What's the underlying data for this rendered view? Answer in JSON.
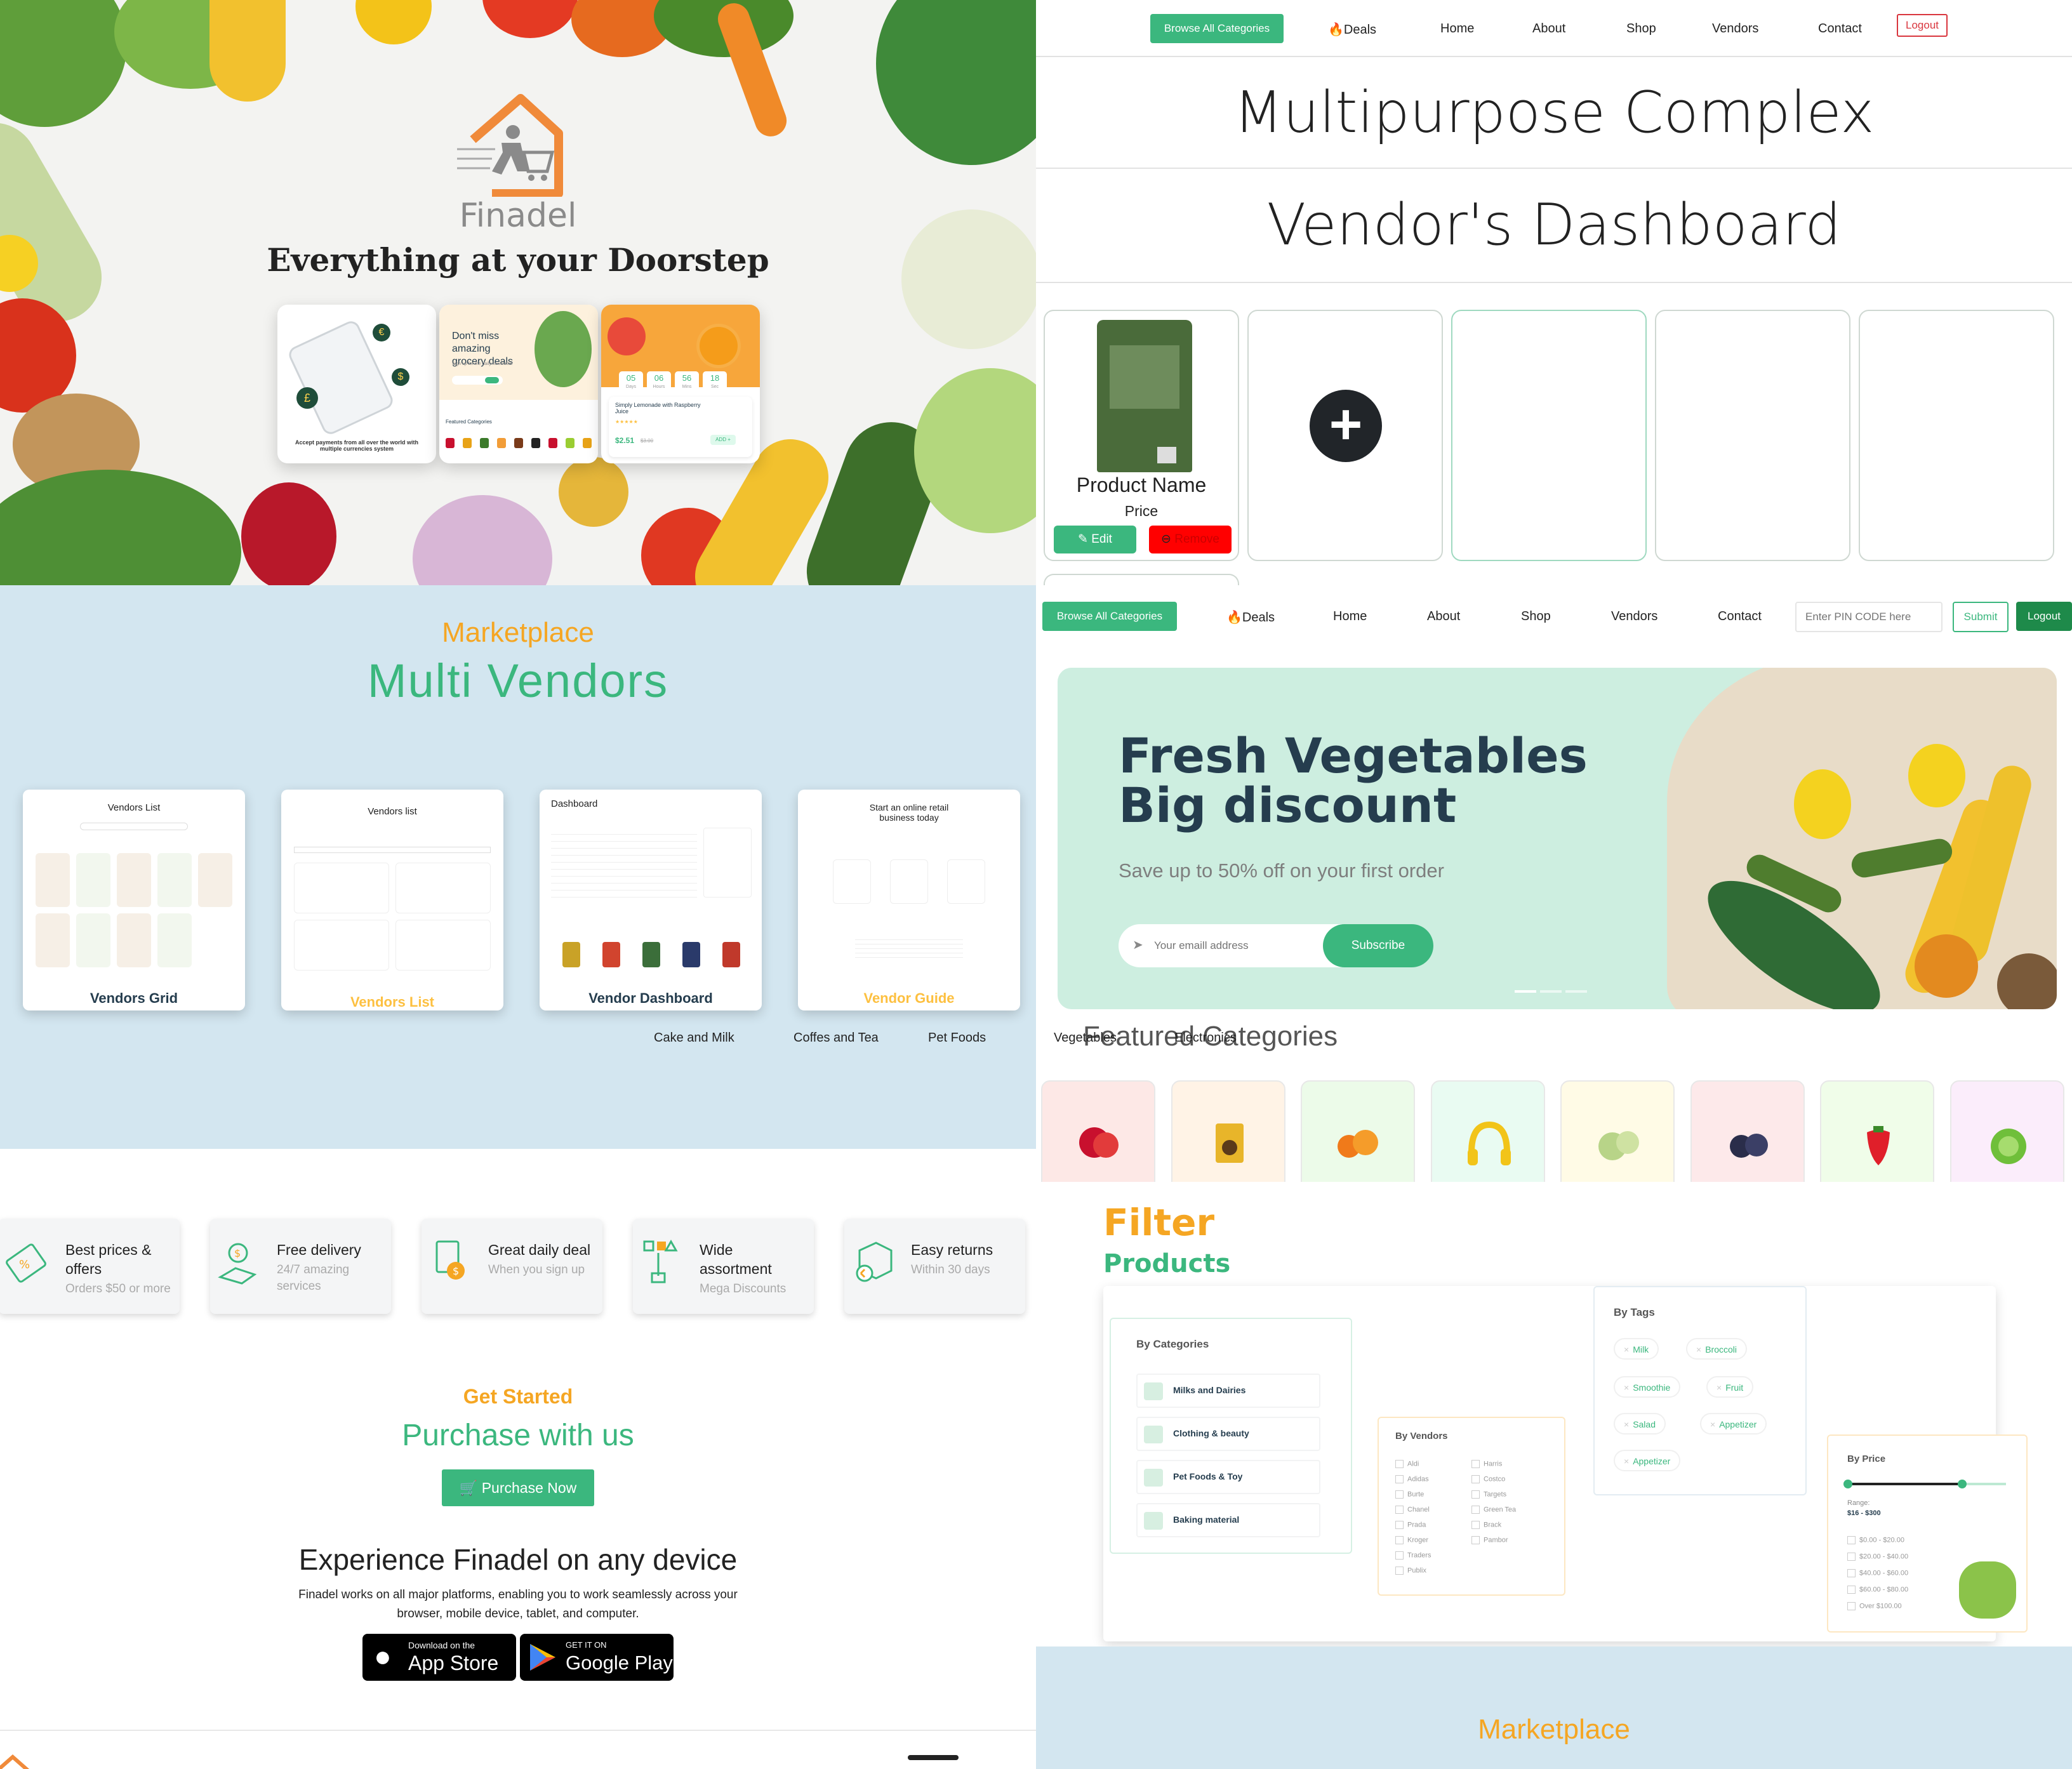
{
  "hero": {
    "brand": "Finadel",
    "tagline": "Everything at your Doorstep",
    "shot1_caption": "Accept payments from all over the world with multiple currencies system",
    "shot2_headline": "Don't miss amazing grocery deals",
    "shot2_sub": "Sign up for the daily newsletter",
    "shot2_section": "Featured Categories",
    "shot3_countdown": [
      {
        "value": "05",
        "unit": "Days"
      },
      {
        "value": "06",
        "unit": "Hours"
      },
      {
        "value": "56",
        "unit": "Mins"
      },
      {
        "value": "18",
        "unit": "Sec"
      }
    ],
    "shot3_product": "Simply Lemonade with Raspberry Juice",
    "shot3_price": "$2.51",
    "shot3_old_price": "$3.00",
    "shot3_add": "ADD +"
  },
  "vendor_nav": {
    "browse": "Browse All Categories",
    "deals": "Deals",
    "home": "Home",
    "about": "About",
    "shop": "Shop",
    "vendors": "Vendors",
    "contact": "Contact",
    "logout": "Logout"
  },
  "dashboard": {
    "title1": "Multipurpose Complex",
    "title2": "Vendor's Dashboard",
    "product_name": "Product Name",
    "price": "Price",
    "edit": "Edit",
    "remove": "Remove",
    "add_icon": "plus-icon"
  },
  "marketplace": {
    "kicker": "Marketplace",
    "title": "Multi Vendors",
    "cards": [
      {
        "header": "Vendors List",
        "label": "Vendors Grid",
        "label_color": "#253d4e"
      },
      {
        "header": "Vendors list",
        "label": "Vendors List",
        "label_color": "#fdc040"
      },
      {
        "header": "Dashboard",
        "label": "Vendor Dashboard",
        "label_color": "#253d4e"
      },
      {
        "header": "Start an online retail business today",
        "label": "Vendor Guide",
        "label_color": "#fdc040"
      }
    ]
  },
  "shop_nav": {
    "browse": "Browse All Categories",
    "deals": "Deals",
    "home": "Home",
    "about": "About",
    "shop": "Shop",
    "vendors": "Vendors",
    "contact": "Contact",
    "pin_placeholder": "Enter PIN CODE here",
    "submit": "Submit",
    "logout": "Logout"
  },
  "banner": {
    "title_line1": "Fresh Vegetables",
    "title_line2": "Big discount",
    "subtitle": "Save up to 50% off on your first order",
    "email_placeholder": "Your emaill address",
    "subscribe": "Subscribe"
  },
  "featured": {
    "title": "Featured Categories",
    "tabs": [
      "Cake and Milk",
      "Coffes and Tea",
      "Pet Foods",
      "Vegetables",
      "Electronics"
    ],
    "tiles": [
      {
        "icon": "apple-icon",
        "bg": "#fde8e6"
      },
      {
        "icon": "snack-bag-icon",
        "bg": "#fff3e6"
      },
      {
        "icon": "persimmon-icon",
        "bg": "#ecfbe9"
      },
      {
        "icon": "headphones-icon",
        "bg": "#e9fbf2"
      },
      {
        "icon": "custard-apple-icon",
        "bg": "#fffbe6"
      },
      {
        "icon": "plum-icon",
        "bg": "#fde9ea"
      },
      {
        "icon": "strawberry-icon",
        "bg": "#f0fde9"
      },
      {
        "icon": "cabbage-icon",
        "bg": "#fbedfb"
      }
    ]
  },
  "features": [
    {
      "title": "Best prices &",
      "title2": "offers",
      "sub": "Orders $50 or more",
      "sub2": "",
      "icon": "price-tag-icon"
    },
    {
      "title": "Free delivery",
      "title2": "",
      "sub": "24/7 amazing",
      "sub2": "services",
      "icon": "delivery-icon"
    },
    {
      "title": "Great daily deal",
      "title2": "",
      "sub": "When you sign up",
      "sub2": "",
      "icon": "deal-icon"
    },
    {
      "title": "Wide",
      "title2": "assortment",
      "sub": "Mega Discounts",
      "sub2": "",
      "icon": "assortment-icon"
    },
    {
      "title": "Easy returns",
      "title2": "",
      "sub": "Within 30 days",
      "sub2": "",
      "icon": "returns-icon"
    }
  ],
  "get_started": {
    "kicker": "Get Started",
    "title": "Purchase with us",
    "button": "Purchase Now",
    "device_title": "Experience Finadel on any device",
    "device_text1": "Finadel works on all major platforms, enabling you to work seamlessly across your",
    "device_text2": "browser, mobile device, tablet, and computer.",
    "appstore_small": "Download on the",
    "appstore_big": "App Store",
    "gplay_small": "GET IT ON",
    "gplay_big": "Google Play"
  },
  "filter": {
    "title": "Filter",
    "subtitle": "Products",
    "by_categories": "By Categories",
    "categories": [
      "Milks and Dairies",
      "Clothing & beauty",
      "Pet Foods & Toy",
      "Baking material"
    ],
    "by_vendors": "By Vendors",
    "vendors_col1": [
      "Aldi",
      "Adidas",
      "Burte",
      "Chanel",
      "Prada",
      "Kroger",
      "Traders",
      "Publix"
    ],
    "vendors_col2": [
      "Harris",
      "Costco",
      "Targets",
      "Green Tea",
      "Brack",
      "Pambor"
    ],
    "by_tags": "By Tags",
    "tags": [
      "Milk",
      "Broccoli",
      "Smoothie",
      "Fruit",
      "Salad",
      "Appetizer",
      "Appetizer"
    ],
    "by_price": "By Price",
    "range_label": "Range:",
    "range_value": "$16 - $300",
    "price_options": [
      "$0.00 - $20.00",
      "$20.00 - $40.00",
      "$40.00 - $60.00",
      "$60.00 - $80.00",
      "Over $100.00"
    ]
  },
  "marketplace2": {
    "kicker": "Marketplace"
  },
  "colors": {
    "brand_green": "#3bb77e",
    "accent_orange": "#f5a623",
    "dark": "#253d4e",
    "danger": "#ff0000"
  }
}
